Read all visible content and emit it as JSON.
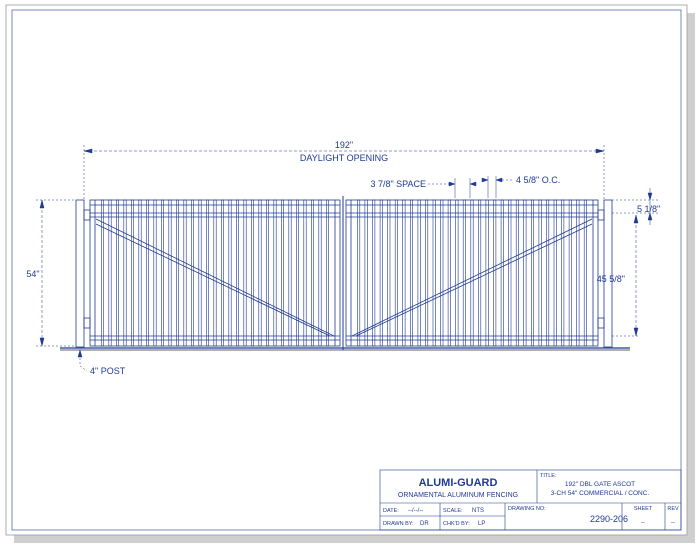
{
  "dimensions": {
    "width_value": "192\"",
    "width_label": "DAYLIGHT OPENING",
    "space": "3 7/8\" SPACE",
    "oc": "4 5/8\" O.C.",
    "top_gap": "5 1/8\"",
    "height_total": "54\"",
    "picket_height": "45 5/8\"",
    "post": "4\" POST"
  },
  "title_block": {
    "company": "ALUMI-GUARD",
    "company_sub": "ORNAMENTAL ALUMINUM FENCING",
    "title_label": "TITLE:",
    "title_line1": "192\" DBL GATE ASCOT",
    "title_line2": "3-CH 54\" COMMERCIAL / CONC.",
    "date_label": "DATE:",
    "date_value": "--/--/--",
    "scale_label": "SCALE:",
    "scale_value": "NTS",
    "drawn_label": "DRAWN BY:",
    "drawn_value": "DR",
    "checked_label": "CHK'D BY:",
    "checked_value": "LP",
    "drawing_no_label": "DRAWING NO:",
    "drawing_no_value": "2290-206",
    "sheet_label": "SHEET",
    "sheet_value": "--",
    "rev_label": "REV",
    "rev_value": "--"
  },
  "colors": {
    "line": "#1f3a93",
    "shadow": "#c9c9c9"
  }
}
